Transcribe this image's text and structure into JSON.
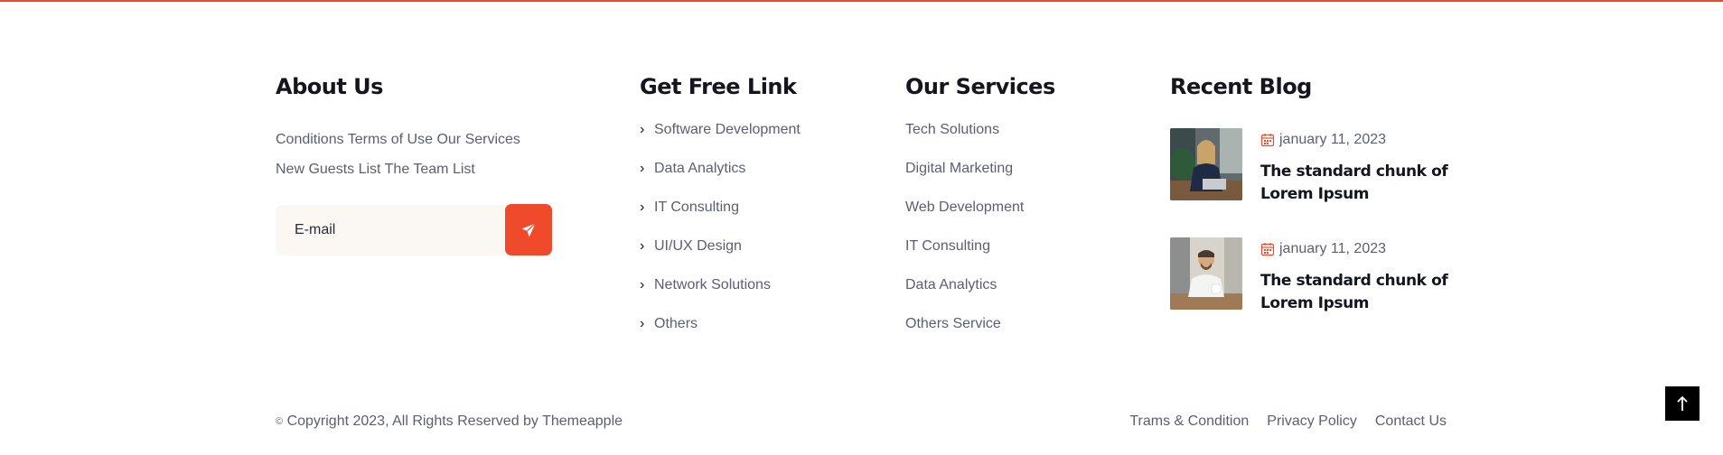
{
  "about": {
    "heading": "About Us",
    "line1": "Conditions Terms of Use Our Services",
    "line2": "New Guests List The Team List",
    "email_placeholder": "E-mail"
  },
  "free_links": {
    "heading": "Get Free Link",
    "items": [
      "Software Development",
      "Data Analytics",
      "IT Consulting",
      "UI/UX Design",
      "Network Solutions",
      "Others"
    ]
  },
  "services": {
    "heading": "Our Services",
    "items": [
      "Tech Solutions",
      "Digital Marketing",
      "Web Development",
      "IT Consulting",
      "Data Analytics",
      "Others Service"
    ]
  },
  "blog": {
    "heading": "Recent Blog",
    "posts": [
      {
        "date": "january 11, 2023",
        "title": "The standard chunk of Lorem Ipsum"
      },
      {
        "date": "january 11, 2023",
        "title": "The standard chunk of Lorem Ipsum"
      }
    ]
  },
  "footer": {
    "copyright": "Copyright 2023, All Rights Reserved by Themeapple",
    "copyright_symbol": "©",
    "links": [
      "Trams & Condition",
      "Privacy Policy",
      "Contact Us"
    ]
  },
  "colors": {
    "accent": "#f04a2c",
    "heading": "#14161f",
    "text": "#5a5f73"
  },
  "icons": {
    "send": "paper-plane-icon",
    "date": "calendar-icon",
    "link_bullet": "chevron-right-icon",
    "back_to_top": "arrow-up-icon"
  }
}
